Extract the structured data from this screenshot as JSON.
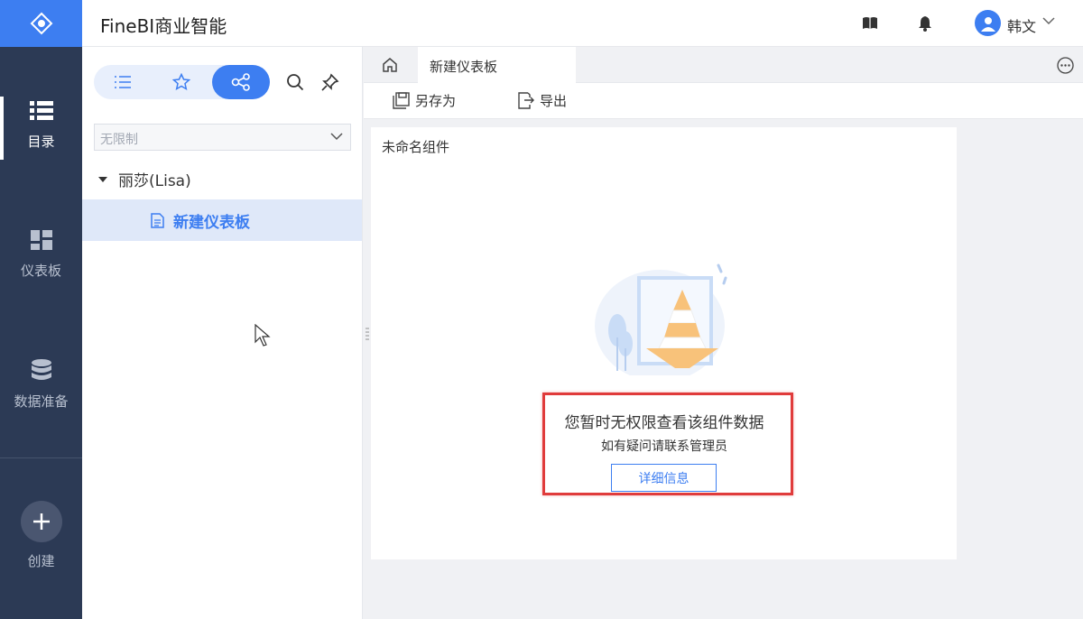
{
  "header": {
    "app_title": "FineBI商业智能",
    "user_name": "韩文",
    "icons": [
      "book-icon",
      "bell-icon",
      "user-avatar-icon",
      "chevron-down-icon"
    ]
  },
  "rail": {
    "items": [
      {
        "label": "目录",
        "icon": "list-icon",
        "active": true
      },
      {
        "label": "仪表板",
        "icon": "dashboard-icon",
        "active": false
      },
      {
        "label": "数据准备",
        "icon": "database-icon",
        "active": false
      }
    ],
    "create_label": "创建"
  },
  "catalog": {
    "segments": [
      "list-icon",
      "star-icon",
      "share-icon"
    ],
    "active_segment": "share-icon",
    "filter_value": "无限制",
    "tree": {
      "node_label": "丽莎(Lisa)",
      "leaf_label": "新建仪表板"
    }
  },
  "tabs": {
    "active_tab_label": "新建仪表板"
  },
  "toolbar": {
    "save_as_label": "另存为",
    "export_label": "导出"
  },
  "widget": {
    "title": "未命名组件",
    "message_main": "您暂时无权限查看该组件数据",
    "message_sub": "如有疑问请联系管理员",
    "detail_button_label": "详细信息"
  },
  "colors": {
    "accent": "#3d7ef1",
    "rail_bg": "#2c3a55",
    "alert_border": "#e03b3b",
    "cone_orange": "#f8c27a"
  }
}
